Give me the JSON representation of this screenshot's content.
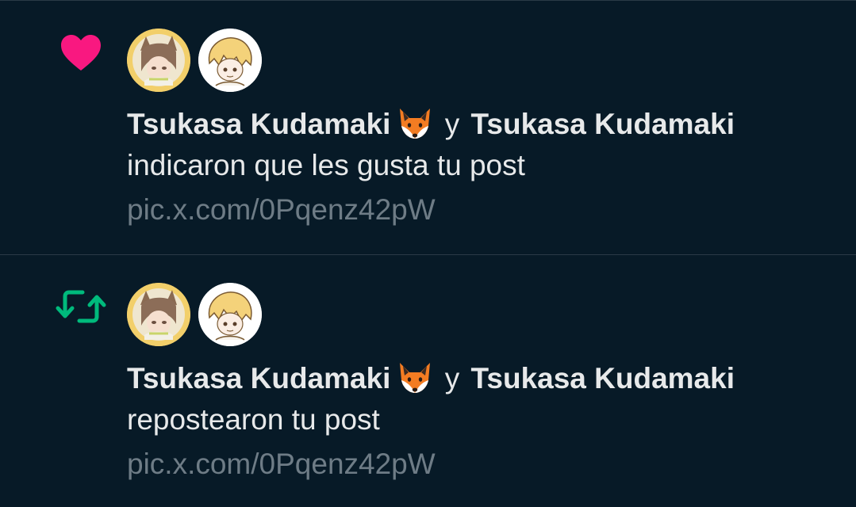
{
  "colors": {
    "background": "#071a27",
    "divider": "#2a3a46",
    "like_pink": "#f91880",
    "repost_green": "#00ba7c",
    "primary_text": "#e7e9ea",
    "secondary_text": "#6e7c86"
  },
  "notifications": [
    {
      "type_icon": "heart-icon",
      "actors": [
        {
          "name": "Tsukasa Kudamaki",
          "emoji": "fox-emoji"
        },
        {
          "name": "Tsukasa Kudamaki"
        }
      ],
      "conjunction": "y",
      "action_text": "indicaron que les gusta tu post",
      "link_text": "pic.x.com/0Pqenz42pW"
    },
    {
      "type_icon": "repost-icon",
      "actors": [
        {
          "name": "Tsukasa Kudamaki",
          "emoji": "fox-emoji"
        },
        {
          "name": "Tsukasa Kudamaki"
        }
      ],
      "conjunction": "y",
      "action_text": "repostearon tu post",
      "link_text": "pic.x.com/0Pqenz42pW"
    }
  ]
}
